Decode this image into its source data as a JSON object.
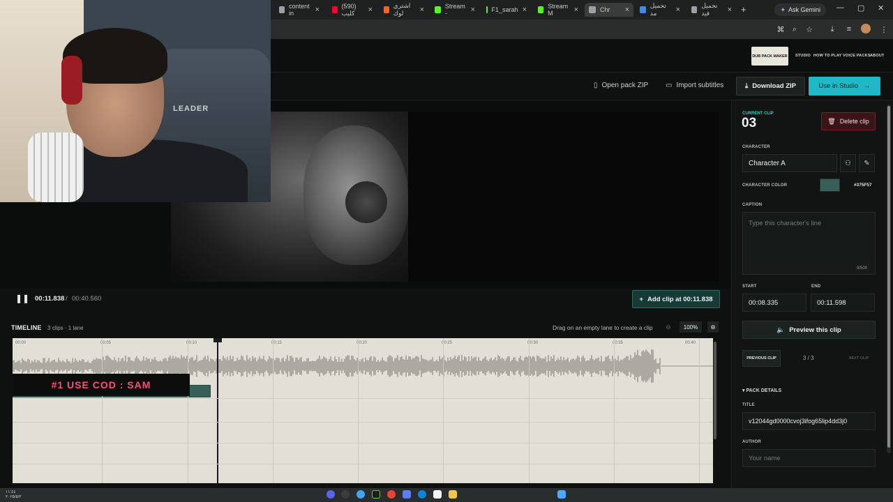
{
  "browser": {
    "tabs": [
      {
        "label": "content in",
        "color": "#9aa0a6"
      },
      {
        "label": "(590) كليب",
        "color": "#ff0033"
      },
      {
        "label": "اشتري لوك",
        "color": "#f26522"
      },
      {
        "label": "Stream -",
        "color": "#53fc18"
      },
      {
        "label": "F1_sarah",
        "color": "#53fc18"
      },
      {
        "label": "Stream M",
        "color": "#53fc18"
      },
      {
        "label": "Chr",
        "color": "#9aa0a6"
      },
      {
        "label": "تحميل مد",
        "color": "#4285f4"
      },
      {
        "label": "تحميل فيد",
        "color": "#9aa0a6"
      }
    ],
    "new_tab": "+",
    "gemini_label": "Ask Gemini",
    "controls": {
      "minimize": "—",
      "restore": "▢",
      "close": "✕"
    }
  },
  "nav": {
    "active": "DUB PACK MAKER",
    "links": [
      "STUDIO",
      "HOW TO PLAY",
      "VOICE PACKS",
      "ABOUT"
    ]
  },
  "toolbar": {
    "open_zip": "Open pack ZIP",
    "import_subs": "Import subtitles",
    "download_zip": "Download ZIP",
    "use_studio": "Use in Studio"
  },
  "webcam": {
    "chair_text": "LEADER"
  },
  "player": {
    "current_time": "00:11.838",
    "separator": "/",
    "total_time": "00:40.560",
    "add_clip": "Add clip at 00:11.838"
  },
  "timeline": {
    "title": "TIMELINE",
    "meta": "3 clips · 1 lane",
    "hint": "Drag on an empty lane to create a clip",
    "zoom": "100%",
    "ticks": [
      "00:00",
      "00:05",
      "00:10",
      "00:15",
      "00:20",
      "00:25",
      "00:30",
      "00:35",
      "00:40"
    ],
    "sponsor_text": "#1 USE COD : SAM"
  },
  "panel": {
    "current_clip_label": "CURRENT CLIP",
    "current_clip_number": "03",
    "delete_clip": "Delete clip",
    "character_label": "CHARACTER",
    "character_value": "Character A",
    "character_color_label": "CHARACTER COLOR",
    "character_color": "#375F57",
    "caption_label": "CAPTION",
    "caption_placeholder": "Type this character's line",
    "caption_count": "0/500",
    "start_label": "START",
    "start_value": "00:08.335",
    "end_label": "END",
    "end_value": "00:11.598",
    "preview_clip": "Preview this clip",
    "previous_clip": "PREVIOUS CLIP",
    "clip_position": "3 / 3",
    "next_clip": "NEXT CLIP",
    "pack_details": "▾ PACK DETAILS",
    "title_label": "TITLE",
    "title_value": "v12044gd0000cvoj3ifog65lip4dd3j0",
    "author_label": "AUTHOR",
    "author_placeholder": "Your name"
  },
  "taskbar": {
    "clock_line1": "١١:٤٤",
    "clock_line2": "٢٠٢٥/٥/٢"
  }
}
